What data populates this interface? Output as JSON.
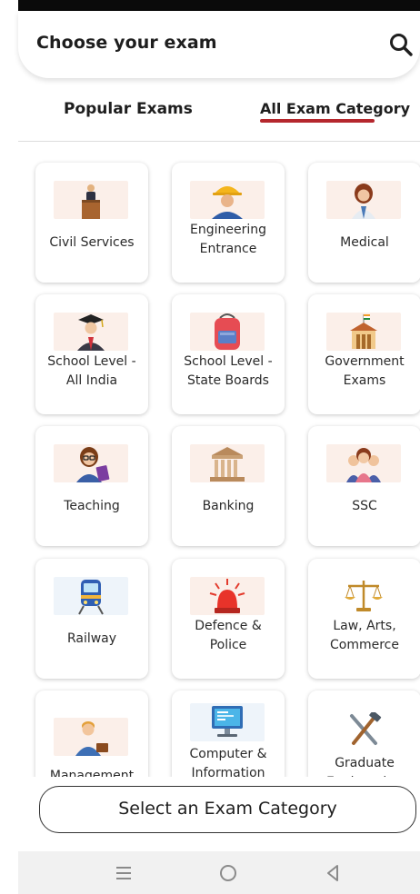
{
  "header": {
    "title": "Choose your exam",
    "search_icon": "search-icon"
  },
  "tabs": [
    {
      "label": "Popular Exams",
      "active": false
    },
    {
      "label": "All Exam Category",
      "active": true
    }
  ],
  "accent_color": "#b5272d",
  "categories": [
    {
      "label": "Civil Services",
      "icon": "podium-speaker-icon"
    },
    {
      "label": "Engineering\nEntrance",
      "icon": "engineer-hardhat-icon"
    },
    {
      "label": "Medical",
      "icon": "doctor-icon"
    },
    {
      "label": "School Level -\nAll India",
      "icon": "graduate-icon"
    },
    {
      "label": "School Level -\nState Boards",
      "icon": "school-bag-icon"
    },
    {
      "label": "Government\nExams",
      "icon": "government-building-icon"
    },
    {
      "label": "Teaching",
      "icon": "teacher-icon"
    },
    {
      "label": "Banking",
      "icon": "bank-icon"
    },
    {
      "label": "SSC",
      "icon": "group-people-icon"
    },
    {
      "label": "Railway",
      "icon": "train-icon"
    },
    {
      "label": "Defence &\nPolice",
      "icon": "siren-icon"
    },
    {
      "label": "Law, Arts,\nCommerce",
      "icon": "scales-icon"
    },
    {
      "label": "Management",
      "icon": "businessman-icon"
    },
    {
      "label": "Computer &\nInformation",
      "icon": "computer-monitor-icon"
    },
    {
      "label": "Graduate\nEngineering",
      "icon": "tools-icon"
    }
  ],
  "footer": {
    "select_button_label": "Select an Exam Category"
  },
  "navbar": {
    "icons": [
      "menu-icon",
      "home-circle-icon",
      "back-triangle-icon"
    ]
  }
}
